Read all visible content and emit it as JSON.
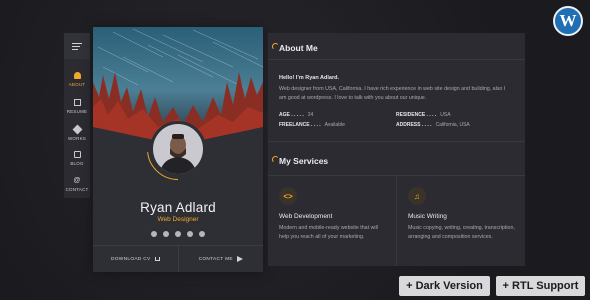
{
  "nav": {
    "items": [
      {
        "label": "ABOUT",
        "icon": "user-icon",
        "active": true
      },
      {
        "label": "RESUME",
        "icon": "document-icon",
        "active": false
      },
      {
        "label": "WORKS",
        "icon": "pen-icon",
        "active": false
      },
      {
        "label": "BLOG",
        "icon": "chat-icon",
        "active": false
      },
      {
        "label": "CONTACT",
        "icon": "at-icon",
        "active": false
      }
    ]
  },
  "profile": {
    "name": "Ryan Adlard",
    "role": "Web Designer",
    "socials": [
      "dribbble-icon",
      "twitter-icon",
      "github-icon",
      "spotify-icon",
      "stackoverflow-icon"
    ],
    "download_cv": "DOWNLOAD CV",
    "contact_me": "CONTACT ME"
  },
  "about": {
    "title": "About Me",
    "greeting": "Hello! I’m Ryan Adlard.",
    "bio": "Web designer from USA, California. I have rich experience in web site design and building, also I am good at wordpress. I love to talk with you about our unique.",
    "info": [
      {
        "key": "AGE . . . . .",
        "value": "24"
      },
      {
        "key": "RESIDENCE . . . .",
        "value": "USA"
      },
      {
        "key": "FREELANCE . . . .",
        "value": "Available"
      },
      {
        "key": "ADDRESS . . . .",
        "value": "California, USA"
      }
    ]
  },
  "services": {
    "title": "My Services",
    "items": [
      {
        "title": "Web Development",
        "icon": "code-icon",
        "text": "Modern and mobile-ready website that will help you reach all of your marketing."
      },
      {
        "title": "Music Writing",
        "icon": "music-note-icon",
        "text": "Music copying, writing, creating, transcription, arranging and composition services."
      }
    ]
  },
  "badges": {
    "dark": "+ Dark Version",
    "rtl": "+ RTL Support"
  },
  "colors": {
    "accent": "#f0a92b",
    "background": "#1e1e22",
    "panel": "#2b2b31"
  }
}
